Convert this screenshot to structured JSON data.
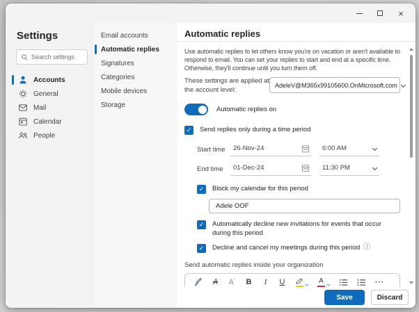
{
  "window": {
    "titlebar": {
      "close_glyph": "×"
    }
  },
  "sidebar": {
    "title": "Settings",
    "search": {
      "placeholder": "Search settings"
    },
    "items": [
      {
        "label": "Accounts",
        "icon": "person-icon",
        "selected": true
      },
      {
        "label": "General",
        "icon": "gear-icon",
        "selected": false
      },
      {
        "label": "Mail",
        "icon": "mail-icon",
        "selected": false
      },
      {
        "label": "Calendar",
        "icon": "calendar-icon",
        "selected": false
      },
      {
        "label": "People",
        "icon": "people-icon",
        "selected": false
      }
    ]
  },
  "nav": {
    "items": [
      {
        "label": "Email accounts",
        "selected": false
      },
      {
        "label": "Automatic replies",
        "selected": true
      },
      {
        "label": "Signatures",
        "selected": false
      },
      {
        "label": "Categories",
        "selected": false
      },
      {
        "label": "Mobile devices",
        "selected": false
      },
      {
        "label": "Storage",
        "selected": false
      }
    ]
  },
  "content": {
    "title": "Automatic replies",
    "description": "Use automatic replies to let others know you're on vacation or aren't available to respond to email. You can set your replies to start and end at a specific time. Otherwise, they'll continue until you turn them off.",
    "account_scope_label": "These settings are applied at the account level:",
    "account_value": "AdeleV@M365x99105600.OnMicrosoft.com",
    "toggle_label": "Automatic replies on",
    "send_period_label": "Send replies only during a time period",
    "start_time": {
      "label": "Start time",
      "date": "26-Nov-24",
      "time": "6:00 AM"
    },
    "end_time": {
      "label": "End time",
      "date": "01-Dec-24",
      "time": "11:30 PM"
    },
    "block_calendar_label": "Block my calendar for this period",
    "event_title_value": "Adele OOF",
    "auto_decline_label": "Automatically decline new invitations for events that occur during this period",
    "decline_cancel_label": "Decline and cancel my meetings during this period",
    "inside_org_label": "Send automatic replies inside your organization",
    "footer": {
      "save_label": "Save",
      "discard_label": "Discard"
    }
  },
  "toolbar": {
    "bold": "B",
    "italic": "I",
    "underline": "U",
    "font_size_letter": "A",
    "clear_format_letter": "A",
    "font_color_letter": "A",
    "more": "···"
  },
  "icons": {
    "info": "ⓘ"
  },
  "colors": {
    "accent": "#0f6cbd",
    "highlight_yellow": "#f2c811",
    "font_color_red": "#d13438"
  }
}
